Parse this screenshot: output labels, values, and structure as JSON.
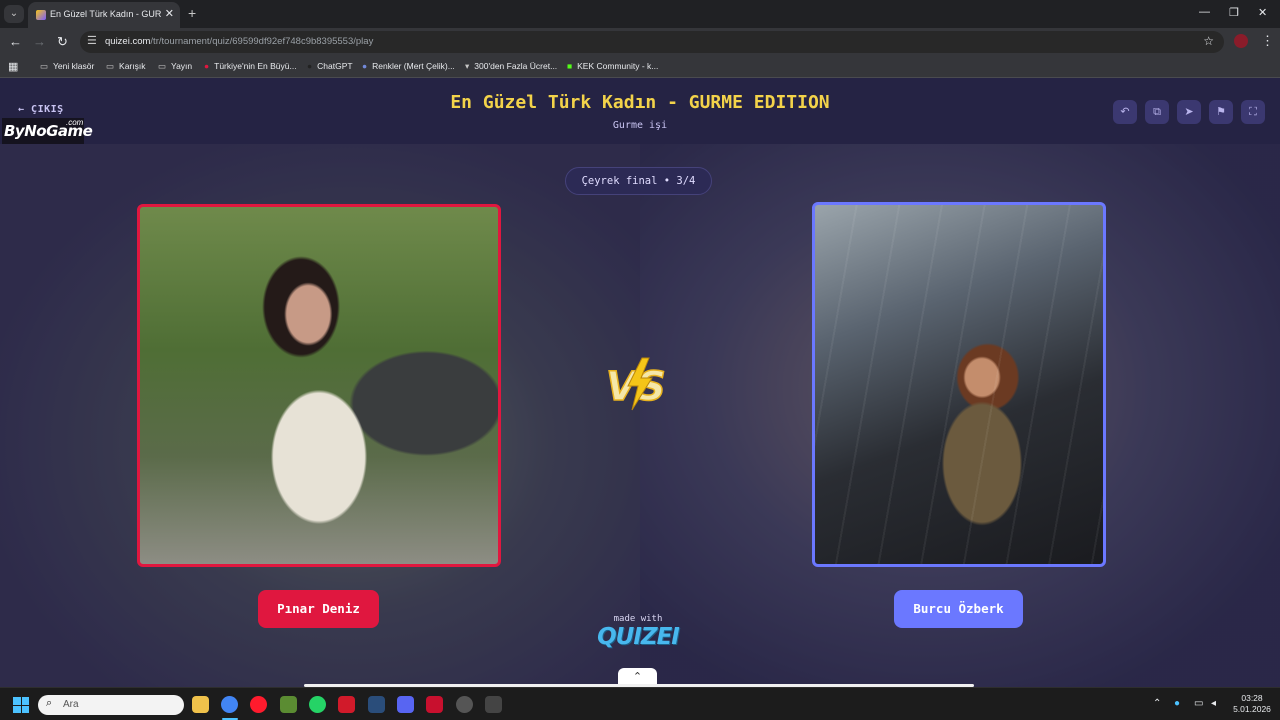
{
  "browser": {
    "tab_title": "En Güzel Türk Kadın - GURME E",
    "url_host": "quizei.com",
    "url_path": "/tr/tournament/quiz/69599df92ef748c9b8395553/play",
    "bookmarks": [
      {
        "icon": "folder-icon",
        "label": "Yeni klasör"
      },
      {
        "icon": "folder-icon",
        "label": "Karışık"
      },
      {
        "icon": "folder-icon",
        "label": "Yayın"
      },
      {
        "icon": "opera-icon",
        "label": "Türkiye'nin En Büyü..."
      },
      {
        "icon": "chatgpt-icon",
        "label": "ChatGPT"
      },
      {
        "icon": "discord-icon",
        "label": "Renkler (Mert Çelik)..."
      },
      {
        "icon": "site-icon",
        "label": "300'den Fazla Ücret..."
      },
      {
        "icon": "kick-icon",
        "label": "KEK Community - k..."
      }
    ]
  },
  "header": {
    "back_label": "ÇIKIŞ",
    "logo_text": "ByNoGame",
    "logo_suffix": ".com",
    "title": "En Güzel Türk Kadın - GURME EDITION",
    "subtitle": "Gurme işi",
    "actions": [
      "undo-icon",
      "share-icon",
      "send-icon",
      "flag-icon",
      "fullscreen-icon"
    ]
  },
  "match": {
    "round_label": "Çeyrek final • 3/4",
    "vs_label": "VS",
    "left": {
      "name": "Pınar Deniz",
      "color": "#e0173f"
    },
    "right": {
      "name": "Burcu Özberk",
      "color": "#6b78ff"
    }
  },
  "footer": {
    "made_with": "made with",
    "brand": "QUIZEI"
  },
  "taskbar": {
    "search_placeholder": "Ara",
    "time": "03:28",
    "date": "5.01.2026"
  }
}
